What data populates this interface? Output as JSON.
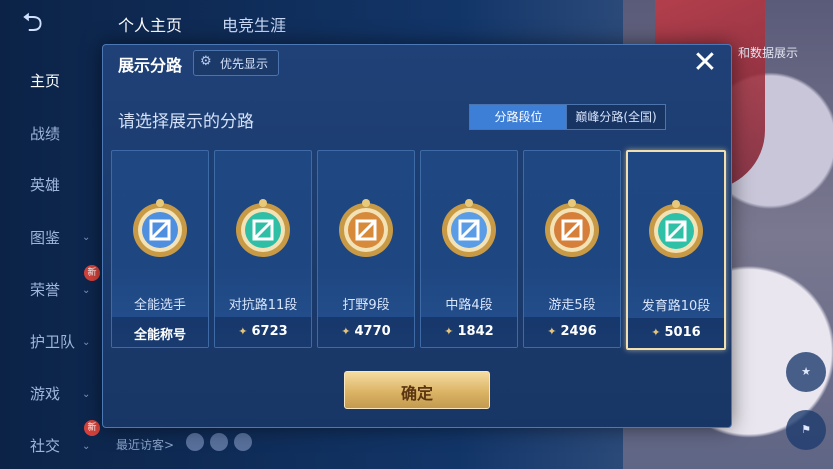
{
  "topbar": {
    "tabs": [
      "个人主页",
      "电竞生涯"
    ]
  },
  "sidebar": {
    "items": [
      {
        "label": "主页"
      },
      {
        "label": "战绩"
      },
      {
        "label": "英雄"
      },
      {
        "label": "图鉴"
      },
      {
        "label": "荣誉"
      },
      {
        "label": "护卫队"
      },
      {
        "label": "游戏"
      },
      {
        "label": "社交"
      }
    ],
    "badge_new": "新"
  },
  "dialog": {
    "title": "展示分路",
    "priority_label": "优先显示",
    "prompt": "请选择展示的分路",
    "segments": [
      "分路段位",
      "巅峰分路(全国)"
    ],
    "confirm_label": "确定",
    "cards": [
      {
        "role": "全能选手",
        "stat": "全能称号",
        "badge_color": "#4f8fe0",
        "selected": false
      },
      {
        "role": "对抗路11段",
        "stat": "6723",
        "badge_color": "#2fbfa6",
        "selected": false
      },
      {
        "role": "打野9段",
        "stat": "4770",
        "badge_color": "#d68a3a",
        "selected": false
      },
      {
        "role": "中路4段",
        "stat": "1842",
        "badge_color": "#5a9de6",
        "selected": false
      },
      {
        "role": "游走5段",
        "stat": "2496",
        "badge_color": "#d67f3a",
        "selected": false
      },
      {
        "role": "发育路10段",
        "stat": "5016",
        "badge_color": "#2fc1a8",
        "selected": true
      }
    ]
  },
  "footer": {
    "visitors_label": "最近访客>"
  },
  "right_panel": {
    "label": "和数据展示"
  },
  "colors": {
    "accent_gold": "#e6c57a",
    "segment_active": "#3d7ed6",
    "selected_border": "#f2dfb0"
  }
}
